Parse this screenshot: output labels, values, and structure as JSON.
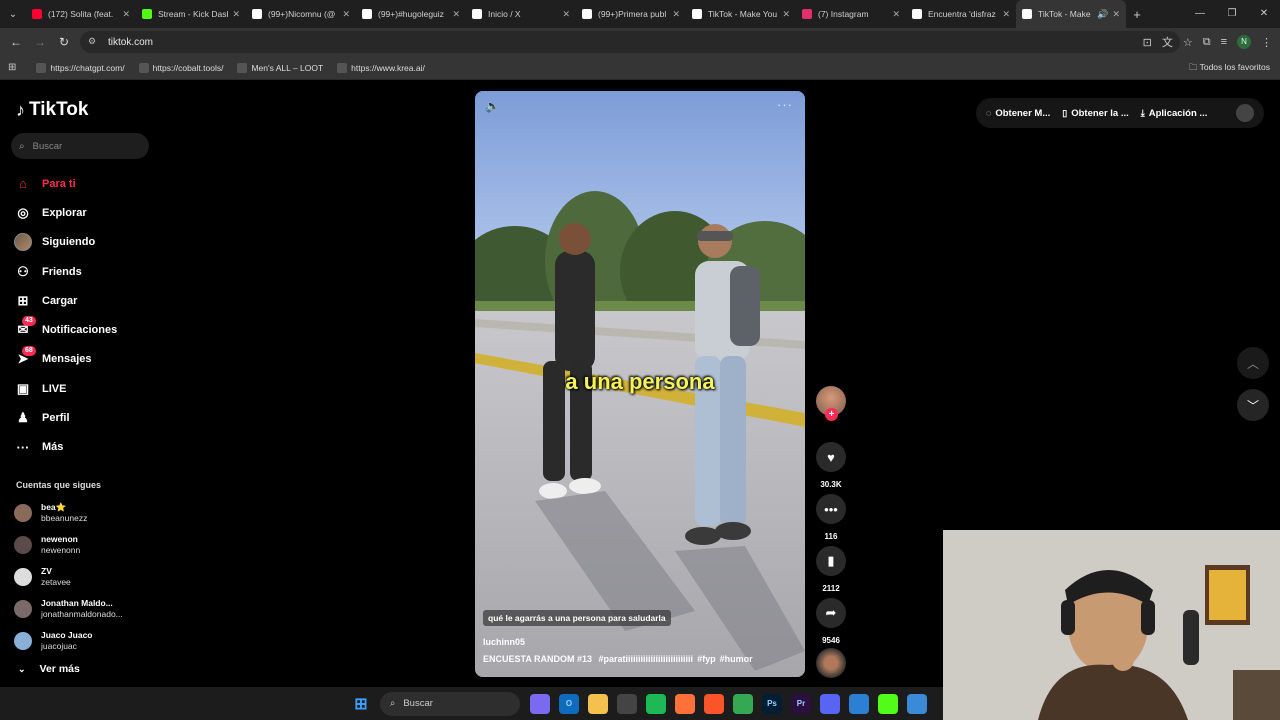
{
  "browser": {
    "tabs": [
      {
        "title": "(172) Solita (feat.",
        "icon": "youtube-icon",
        "color": "#ff0033"
      },
      {
        "title": "Stream - Kick Dash",
        "icon": "kick-icon",
        "color": "#53fc18"
      },
      {
        "title": "(99+)Nicomnu (@",
        "icon": "tiktok-icon",
        "color": "#ffffff"
      },
      {
        "title": "(99+)#hugoleguiz",
        "icon": "tiktok-icon",
        "color": "#ffffff"
      },
      {
        "title": "Inicio / X",
        "icon": "x-icon",
        "color": "#ffffff"
      },
      {
        "title": "(99+)Primera publ",
        "icon": "tiktok-icon",
        "color": "#ffffff"
      },
      {
        "title": "TikTok - Make You",
        "icon": "tiktok-icon",
        "color": "#ffffff"
      },
      {
        "title": "(7) Instagram",
        "icon": "instagram-icon",
        "color": "#e1306c"
      },
      {
        "title": "Encuentra 'disfraz",
        "icon": "tiktok-icon",
        "color": "#ffffff"
      },
      {
        "title": "TikTok - Make",
        "icon": "tiktok-icon",
        "color": "#ffffff",
        "active": true
      }
    ],
    "url": "tiktok.com",
    "bookmarks": [
      {
        "label": "https://chatgpt.com/",
        "icon": "openai-icon"
      },
      {
        "label": "https://cobalt.tools/",
        "icon": "cobalt-icon"
      },
      {
        "label": "Men's ALL – LOOT",
        "icon": "loot-icon"
      },
      {
        "label": "https://www.krea.ai/",
        "icon": "krea-icon"
      }
    ],
    "all_bookmarks": "Todos los favoritos",
    "profile_initial": "N"
  },
  "tiktok": {
    "logo": "TikTok",
    "search_placeholder": "Buscar",
    "nav": [
      {
        "label": "Para ti",
        "icon": "home-icon",
        "active": true
      },
      {
        "label": "Explorar",
        "icon": "compass-icon"
      },
      {
        "label": "Siguiendo",
        "icon": "following-avatar-icon"
      },
      {
        "label": "Friends",
        "icon": "friends-icon"
      },
      {
        "label": "Cargar",
        "icon": "upload-icon"
      },
      {
        "label": "Notificaciones",
        "icon": "inbox-icon",
        "badge": "43"
      },
      {
        "label": "Mensajes",
        "icon": "messages-icon",
        "badge": "68"
      },
      {
        "label": "LIVE",
        "icon": "live-icon"
      },
      {
        "label": "Perfil",
        "icon": "profile-icon"
      },
      {
        "label": "Más",
        "icon": "more-icon"
      }
    ],
    "following_title": "Cuentas que sigues",
    "following": [
      {
        "name": "bea⭐",
        "handle": "bbeanunezz",
        "color": "#8a6a5a"
      },
      {
        "name": "newenon",
        "handle": "newenonn",
        "color": "#5a4a4a"
      },
      {
        "name": "ZV",
        "handle": "zetavee",
        "color": "#dddddd"
      },
      {
        "name": "Jonathan Maldo...",
        "handle": "jonathanmaldonado...",
        "color": "#7a6a6a"
      },
      {
        "name": "Juaco Juaco",
        "handle": "juacojuac",
        "color": "#8ab0d8"
      }
    ],
    "see_more": "Ver más",
    "top_buttons": [
      {
        "label": "Obtener M...",
        "icon": "coin-icon"
      },
      {
        "label": "Obtener la ...",
        "icon": "phone-icon"
      },
      {
        "label": "Aplicación ...",
        "icon": "download-icon"
      }
    ],
    "video": {
      "subtitle": "a una persona",
      "caption": "qué le agarrás a una persona para saludarla",
      "author": "luchinn05",
      "description": "ENCUESTA RANDOM #13",
      "hashtags": [
        "#paratiiiiiiiiiiiiiiiiiiiiiiiiiii",
        "#fyp",
        "#humor"
      ]
    },
    "actions": {
      "likes": "30.3K",
      "comments": "116",
      "saves": "2112",
      "shares": "9546"
    }
  },
  "taskbar": {
    "search_placeholder": "Buscar",
    "apps": [
      {
        "icon": "copilot-icon",
        "color": "#7a6af0"
      },
      {
        "icon": "outlook-icon",
        "color": "#0f6cbd",
        "glyph": "O"
      },
      {
        "icon": "folder-icon",
        "color": "#f2c14e"
      },
      {
        "icon": "chatgpt-icon",
        "color": "#444444"
      },
      {
        "icon": "spotify-icon",
        "color": "#1db954"
      },
      {
        "icon": "firefox-icon",
        "color": "#ff7139"
      },
      {
        "icon": "brave-icon",
        "color": "#fb542b"
      },
      {
        "icon": "chrome-icon",
        "color": "#34a853"
      },
      {
        "icon": "photoshop-icon",
        "color": "#001e36",
        "glyph": "Ps"
      },
      {
        "icon": "premiere-icon",
        "color": "#2a0f3f",
        "glyph": "Pr"
      },
      {
        "icon": "discord-icon",
        "color": "#5865f2"
      },
      {
        "icon": "store-icon",
        "color": "#2d7fd3"
      },
      {
        "icon": "kick-app-icon",
        "color": "#53fc18"
      },
      {
        "icon": "photos-icon",
        "color": "#3a8ad8"
      }
    ]
  }
}
